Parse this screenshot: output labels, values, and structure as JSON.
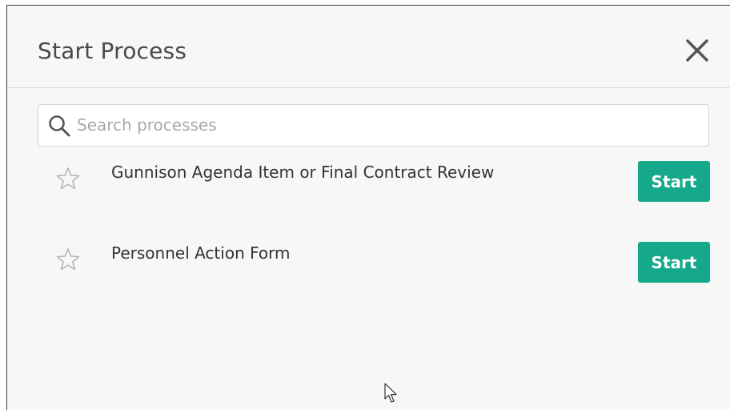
{
  "modal": {
    "title": "Start Process"
  },
  "search": {
    "placeholder": "Search processes"
  },
  "processes": [
    {
      "name": "Gunnison Agenda Item or Final Contract Review",
      "start_label": "Start"
    },
    {
      "name": "Personnel Action Form",
      "start_label": "Start"
    }
  ],
  "colors": {
    "accent": "#16a88a",
    "title_text": "#4a4a4a",
    "star_outline": "#b5b5b5"
  },
  "icons": {
    "close": "close-icon",
    "search": "search-icon",
    "favorite": "star-outline-icon",
    "pointer": "mouse-cursor-icon"
  }
}
